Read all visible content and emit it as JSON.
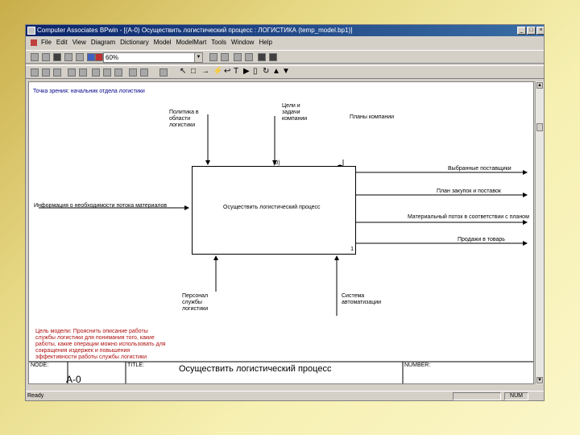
{
  "window": {
    "title": "Computer Associates BPwin - [(A-0) Осуществить логистический процесс : ЛОГИСТИКА (temp_model.bp1)]",
    "controls": [
      "_",
      "□",
      "×"
    ]
  },
  "menu": {
    "items": [
      "File",
      "Edit",
      "View",
      "Diagram",
      "Dictionary",
      "Model",
      "ModelMart",
      "Tools",
      "Window",
      "Help"
    ]
  },
  "toolbar": {
    "zoom_value": "60%"
  },
  "diagram": {
    "viewpoint": "Точка зрения: начальник отдела логистики",
    "controls": [
      {
        "text": "Политика в области логистики"
      },
      {
        "text": "Цели и задачи компании"
      },
      {
        "text": "Планы компании"
      }
    ],
    "activity_label": "Осуществить логистический процесс",
    "box_cost": "(0)",
    "box_number": "1",
    "inputs": [
      {
        "text": "Информация о необходимости потока материалов"
      }
    ],
    "outputs": [
      {
        "text": "Выбранные поставщики"
      },
      {
        "text": "План закупок и поставок"
      },
      {
        "text": "Материальный поток в соответствии с планом"
      },
      {
        "text": "Продажи в товарь"
      }
    ],
    "mechanisms": [
      {
        "text": "Персонал службы логистики"
      },
      {
        "text": "Система автоматизации"
      }
    ],
    "purpose": "Цель модели: Прояснить описание работы службы логистики для понимания того, какие работы, какие операции можно использовать для сокращения издержек и повышения эффективности работы службы логистики"
  },
  "title_block": {
    "node_label": "NODE:",
    "node_value": "A-0",
    "title_label": "TITLE:",
    "title_value": "Осуществить логистический процесс",
    "number_label": "NUMBER:"
  },
  "status": {
    "text": "Ready",
    "num": "NUM"
  }
}
